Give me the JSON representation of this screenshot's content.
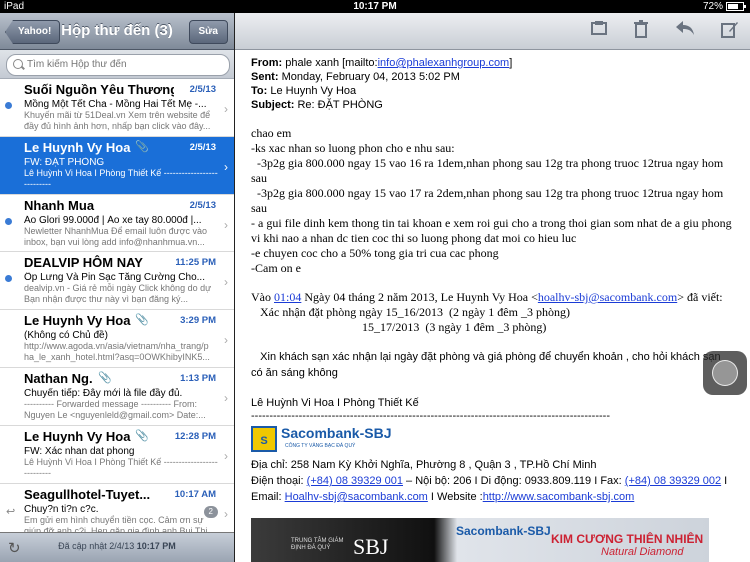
{
  "status": {
    "carrier": "iPad",
    "time": "10:17 PM",
    "battery": "72%",
    "battery_level": 0.72
  },
  "mailbox": {
    "back_label": "Yahoo!",
    "title": "Hộp thư đến (3)",
    "edit_label": "Sửa",
    "search_placeholder": "Tìm kiếm Hộp thư đến",
    "messages": [
      {
        "sender": "Suối Nguồn Yêu Thương",
        "date": "2/5/13",
        "subject": "Mồng Một Tết Cha - Mồng Hai Tết Mẹ -...",
        "preview": "Khuyến mãi từ 51Deal.vn Xem trên website để đầy đủ hình ảnh hơn, nhấp bạn click vào đây...",
        "unread": true
      },
      {
        "sender": "Le Huynh Vy Hoa",
        "date": "2/5/13",
        "subject": "FW: ĐẶT PHÒNG",
        "preview": "Lê Huỳnh Vi Hoa I Phòng Thiết Kế ---------------------------",
        "unread": false
      },
      {
        "sender": "Nhanh Mua",
        "date": "2/5/13",
        "subject": "Áo Glori 99.000đ | Áo xe tay 80.000đ |...",
        "preview": "Newletter NhanhMua Để email luôn được vào inbox, bạn vui lòng add info@nhanhmua.vn...",
        "unread": true
      },
      {
        "sender": "DEALVIP HÔM NAY",
        "date": "11:25 PM",
        "subject": "Ốp Lưng Và Pin Sạc Tăng Cường Cho...",
        "preview": "dealvip.vn - Giá rẻ mỗi ngày Click không do dự Bạn nhận được thư này vì bạn đăng ký...",
        "unread": true
      },
      {
        "sender": "Le Huynh Vy Hoa",
        "date": "3:29 PM",
        "subject": "(Không có Chủ đề)",
        "preview": "http://www.agoda.vn/asia/vietnam/nha_trang/p ha_le_xanh_hotel.html?asq=0OWKhibyINK5...",
        "unread": false
      },
      {
        "sender": "Nathan Ng.",
        "date": "1:13 PM",
        "subject": "Chuyển tiếp: Đây mới là file đầy đủ.",
        "preview": "---------- Forwarded message ---------- From: Nguyen Le <nguyenleld@gmail.com> Date:...",
        "unread": false
      },
      {
        "sender": "Le Huynh Vy Hoa",
        "date": "12:28 PM",
        "subject": "FW: Xác nhan dat phong",
        "preview": "Lê Huỳnh Vi Hoa I Phòng Thiết Kế ---------------------------",
        "unread": false
      },
      {
        "sender": "Seagullhotel-Tuyet...",
        "date": "10:17 AM",
        "subject": "Chuy?n ti?n c?c.",
        "preview": "Em gửi em hình chuyển tiền cọc. Cảm ơn sự giúp đỡ anh c?i. Hẹn gặp gia đình anh Bui Thi...",
        "unread": false,
        "replied": true,
        "count": "2"
      }
    ],
    "updated_label": "Đã cập nhật",
    "updated_date": "2/4/13",
    "updated_time": "10:17 PM"
  },
  "email": {
    "from_label": "From:",
    "from_value": "phale xanh [mailto:",
    "from_email": "info@phalexanhgroup.com",
    "from_end": "]",
    "sent_label": "Sent:",
    "sent_value": "Monday, February 04, 2013 5:02 PM",
    "to_label": "To:",
    "to_value": "Le Huynh Vy Hoa",
    "subject_label": "Subject:",
    "subject_value": "Re: ĐẶT PHÒNG",
    "body_lines": [
      "chao em",
      "-ks xac nhan so luong phon cho e nhu sau:",
      "  -3p2g gia 800.000 ngay 15 vao 16 ra 1dem,nhan phong sau 12g tra phong truoc 12trua ngay hom",
      "sau",
      "  -3p2g gia 800.000 ngay 15 vao 17 ra 2dem,nhan phong sau 12g tra phong truoc 12trua ngay hom",
      "sau",
      "- a gui file dinh kem thong tin tai khoan e xem roi gui cho a trong thoi gian som nhat de a giu phong",
      "vi khi nao a nhan dc tien coc thi so luong phong dat moi co hieu luc",
      "-e chuyen coc cho a 50% tong gia tri cua cac phong",
      "-Cam on e"
    ],
    "quote_pre": "Vào ",
    "quote_time": "01:04",
    "quote_mid": " Ngày 04 tháng 2 năm 2013, Le Huynh Vy Hoa <",
    "quote_email": "hoalhv-sbj@sacombank.com",
    "quote_end": "> đã viết:",
    "confirm_line1": "   Xác nhận đặt phòng ngày 15_16/2013  (2 ngày 1 đêm _3 phòng)",
    "confirm_line2": "                                     15_17/2013  (3 ngày 1 đêm _3 phòng)",
    "request_line1": "   Xin khách sạn xác nhận lại ngày đặt phòng và giá phòng để chuyển khoản , cho hỏi khách sạn",
    "request_line2": "có ăn sáng không",
    "signature_name": "Lê Huỳnh Vi Hoa I Phòng Thiết Kế",
    "separator": "--------------------------------------------------------------------------------------------------",
    "logo_text": "Sacombank-SBJ",
    "logo_tagline": "CÔNG TY VÀNG BẠC ĐÁ QUÝ",
    "address": "Địa chỉ: 258 Nam Kỳ Khởi Nghĩa, Phường 8 , Quận 3 , TP.Hồ Chí Minh",
    "phone_label": "Điện thoại: ",
    "phone": "(+84) 08 39329 001",
    "phone_mid": " – Nội bộ: 206 I Di động: 0933.809.119 I Fax: ",
    "fax": "(+84) 08 39329 002",
    "fax_end": " I",
    "email_label": "Email: ",
    "email": "Hoalhv-sbj@sacombank.com",
    "website_label": " I Website :",
    "website": "http://www.sacombank-sbj.com",
    "banner_left": "TRUNG TÂM GIÁM ĐỊNH ĐÁ QUÝ",
    "banner_sbj": "SBJ",
    "banner_logo": "Sacombank-SBJ",
    "banner_right1": "KIM CƯƠNG THIÊN NHIÊN",
    "banner_right2": "Natural Diamond"
  }
}
